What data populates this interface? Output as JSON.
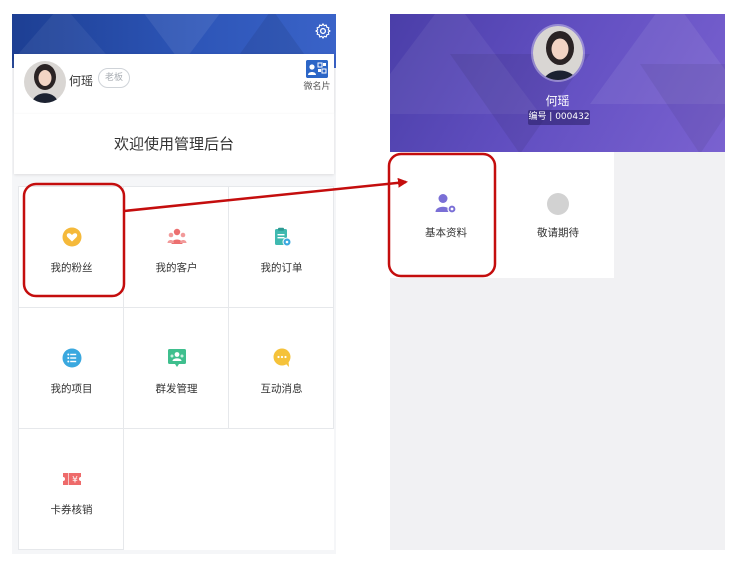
{
  "left_screen": {
    "user_name": "何瑶",
    "role_badge": "老板",
    "vcard_label": "微名片",
    "welcome": "欢迎使用管理后台",
    "menu": [
      {
        "label": "我的粉丝",
        "icon": "heart-icon",
        "color": "#f5b93a"
      },
      {
        "label": "我的客户",
        "icon": "customers-icon",
        "color": "#ec6f6f"
      },
      {
        "label": "我的订单",
        "icon": "order-clipboard-icon",
        "color": "#3fb9b0"
      },
      {
        "label": "我的项目",
        "icon": "project-list-icon",
        "color": "#3aa8df"
      },
      {
        "label": "群发管理",
        "icon": "group-message-icon",
        "color": "#3fbf8e"
      },
      {
        "label": "互动消息",
        "icon": "chat-bubble-icon",
        "color": "#f5c23a"
      },
      {
        "label": "卡券核销",
        "icon": "coupon-icon",
        "color": "#ee6b6b"
      }
    ]
  },
  "right_screen": {
    "user_name": "何瑶",
    "id_badge": "编号 | 000432",
    "tiles": [
      {
        "label": "基本资料",
        "icon": "profile-settings-icon",
        "color": "#7a6fd6"
      },
      {
        "label": "敬请期待",
        "icon": "placeholder-circle-icon",
        "color": "#cfcfcf"
      }
    ]
  },
  "annotation": {
    "highlight_color": "#c40d0d"
  },
  "colors": {
    "left_header": "#2547a6",
    "right_header": "#5c4bbd"
  }
}
